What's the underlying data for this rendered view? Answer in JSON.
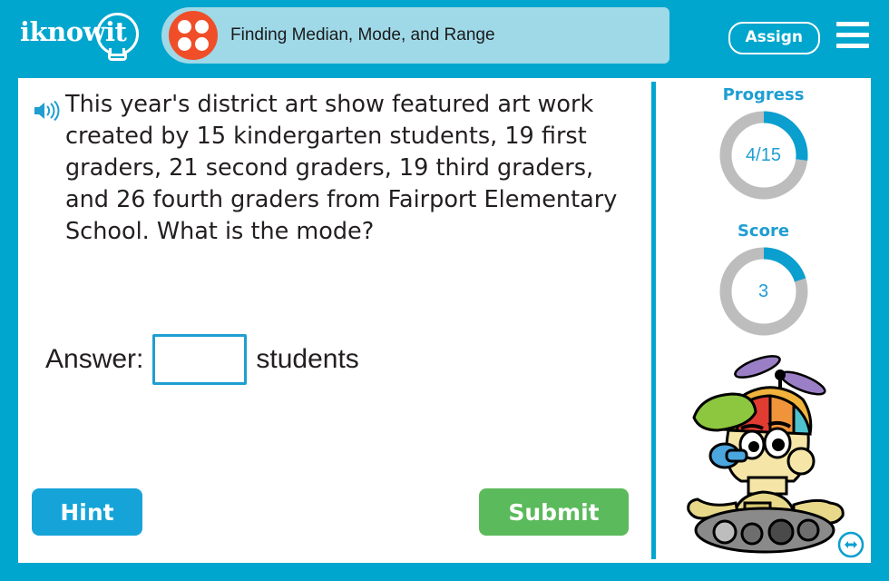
{
  "header": {
    "logo_text": "iknowit",
    "logo_icon": "lightbulb-icon",
    "dice_icon": "dice-four-icon",
    "title": "Finding Median, Mode, and Range",
    "assign_label": "Assign",
    "menu_icon": "hamburger-menu-icon"
  },
  "question": {
    "speaker_icon": "speaker-audio-icon",
    "text": "This year's district art show featured art work created by 15 kindergarten students, 19 first graders, 21 second graders, 19 third graders, and 26 fourth graders from Fairport Elementary School. What is the mode?"
  },
  "answer": {
    "label": "Answer:",
    "value": "",
    "placeholder": "",
    "unit": "students"
  },
  "actions": {
    "hint_label": "Hint",
    "submit_label": "Submit"
  },
  "sidebar": {
    "progress": {
      "label": "Progress",
      "value": "4/15",
      "current": 4,
      "total": 15,
      "percent": 27
    },
    "score": {
      "label": "Score",
      "value": "3",
      "current": 3,
      "percent": 20
    },
    "mascot_icon": "robot-mascot-propeller-hat",
    "nav_icon": "left-right-arrows-icon"
  },
  "colors": {
    "brand_cyan": "#00A6CE",
    "title_bar": "#9FD9E8",
    "accent_orange": "#F04E28",
    "submit_green": "#5BBA5B",
    "hint_blue": "#16A4D8",
    "ring_track": "#BDBDBD",
    "ring_fill": "#0B9FD0",
    "text_dark": "#231f20"
  }
}
